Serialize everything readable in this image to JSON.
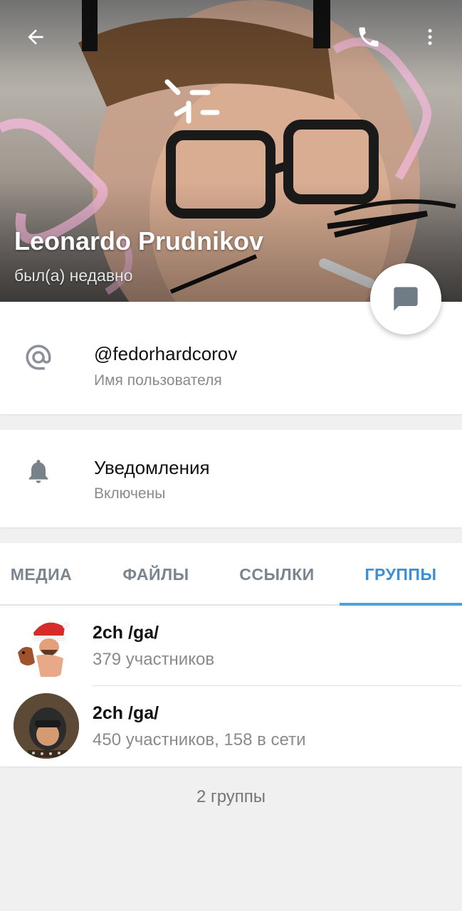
{
  "header": {
    "name": "Leonardo Prudnikov",
    "status": "был(а) недавно",
    "back_icon": "arrow-left-icon",
    "call_icon": "phone-icon",
    "more_icon": "more-vertical-icon",
    "fab_icon": "chat-bubble-icon"
  },
  "username": {
    "value": "@fedorhardcorov",
    "label": "Имя пользователя",
    "icon": "at-sign-icon"
  },
  "notifications": {
    "title": "Уведомления",
    "value": "Включены",
    "icon": "bell-icon"
  },
  "tabs": {
    "items": [
      {
        "label": "МЕДИА"
      },
      {
        "label": "ФАЙЛЫ"
      },
      {
        "label": "ССЫЛКИ"
      },
      {
        "label": "ГРУППЫ"
      }
    ],
    "active_index": 3
  },
  "groups": [
    {
      "title": "2ch /ga/",
      "subtitle": "379 участников"
    },
    {
      "title": "2ch /ga/",
      "subtitle": "450 участников, 158 в сети"
    }
  ],
  "footer": {
    "count_text": "2 группы"
  },
  "colors": {
    "accent": "#3a8fd6",
    "tab_inactive": "#7a8590",
    "secondary_text": "#8a8a8a",
    "background": "#f0f0f0"
  }
}
